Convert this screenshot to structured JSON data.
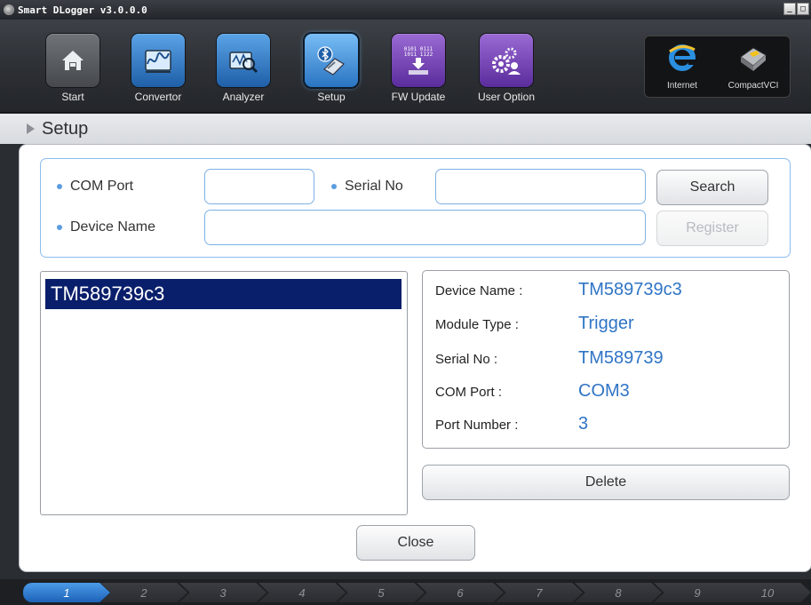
{
  "window": {
    "title": "Smart DLogger v3.0.0.0",
    "controls": [
      "_",
      "□"
    ]
  },
  "toolbar": {
    "items": [
      {
        "label": "Start",
        "icon": "home-icon"
      },
      {
        "label": "Convertor",
        "icon": "waveform-icon"
      },
      {
        "label": "Analyzer",
        "icon": "magnifier-icon"
      },
      {
        "label": "Setup",
        "icon": "bluetooth-device-icon",
        "active": true
      },
      {
        "label": "FW Update",
        "icon": "chip-download-icon",
        "badge": "0101 0111\n1011 1122"
      },
      {
        "label": "User Option",
        "icon": "gear-user-icon"
      }
    ],
    "right": [
      {
        "label": "Internet",
        "icon": "internet-explorer-icon"
      },
      {
        "label": "CompactVCI",
        "icon": "vci-device-icon"
      }
    ]
  },
  "section": {
    "title": "Setup"
  },
  "form": {
    "com_port_label": "COM Port",
    "com_port_value": "",
    "serial_no_label": "Serial No",
    "serial_no_value": "",
    "device_name_label": "Device Name",
    "device_name_value": "",
    "search_label": "Search",
    "register_label": "Register"
  },
  "device_list": [
    {
      "name": "TM589739c3",
      "selected": true
    }
  ],
  "device_info": [
    {
      "key": "Device Name :",
      "value": "TM589739c3"
    },
    {
      "key": "Module Type :",
      "value": "Trigger"
    },
    {
      "key": "Serial No :",
      "value": "TM589739"
    },
    {
      "key": "COM Port :",
      "value": "COM3"
    },
    {
      "key": "Port Number :",
      "value": "3"
    }
  ],
  "actions": {
    "delete_label": "Delete",
    "close_label": "Close"
  },
  "steps": [
    "1",
    "2",
    "3",
    "4",
    "5",
    "6",
    "7",
    "8",
    "9",
    "10"
  ],
  "active_step": "1",
  "colors": {
    "accent": "#2f74c5",
    "selection": "#0a1f6b",
    "field_border": "#7fb0e3"
  }
}
